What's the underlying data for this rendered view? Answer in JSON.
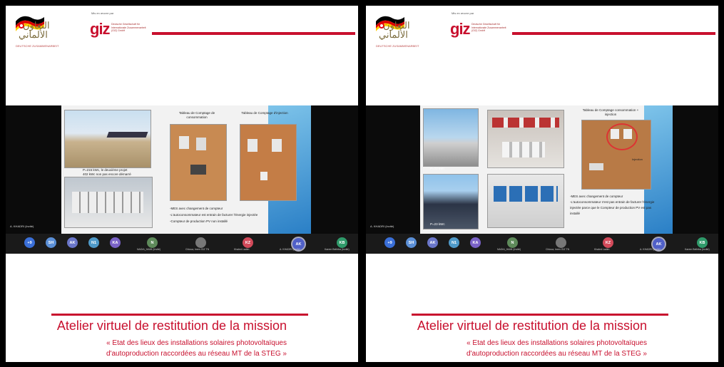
{
  "header": {
    "arabic_line1": "التعاون",
    "arabic_line2": "الألماني",
    "coop_label": "DEUTSCHE ZUSAMMENARBEIT",
    "mandate": "Mis en œuvre par",
    "giz_logo": "giz",
    "giz_desc": "Deutsche Gesellschaft für Internationale Zusammenarbeit (GIZ) GmbH"
  },
  "left": {
    "captions": [
      "P=215 kWc, le deuxième projet",
      "402 kWc non pas encore démarré"
    ],
    "board1_title": "Tableau de Comptage de consommation",
    "board2_title": "Tableau de Comptage d'injection",
    "bullets": [
      "-MES avec changement de compteur",
      "-L'autoconsommateur est entrain de facturer l'énergie injectée",
      "-Compteur de production PV non installé"
    ],
    "tile_name": "A. KHADRI (Invité)"
  },
  "right": {
    "photo_caption_1": "P=23 kWc",
    "photo_caption_2": "P=23 kWc",
    "board_title": "Tableau de Comptage consommation + injection",
    "injection_label": "Injection",
    "bullets": [
      "-MES avec changement de compteur",
      "-L'autoconsommateur n'est pas entrain de facturer l'énergie injectée parce que le Compteur de production PV est pas installé"
    ],
    "tile_name": "A. KHADRI (Invité)"
  },
  "participants": [
    {
      "initials": "+9",
      "color": "#3a6fd8"
    },
    {
      "initials": "SH",
      "color": "#5b8fd6"
    },
    {
      "initials": "AK",
      "color": "#6a76c9"
    },
    {
      "initials": "N1",
      "color": "#4f9ac9"
    },
    {
      "initials": "KA",
      "color": "#7a62c7"
    },
    {
      "initials": "N",
      "color": "#5e8a5a",
      "name": "NADIA_HAMI (Invité)"
    },
    {
      "initials": "",
      "color": "#777",
      "name": "Chloua, Imen GIZ TN"
    },
    {
      "initials": "KZ",
      "color": "#d24a5a",
      "name": "Khaled Ladim"
    },
    {
      "initials": "AK",
      "color": "#5060c8",
      "name": "A. KHADRI (Invité)"
    },
    {
      "initials": "KB",
      "color": "#2f9a6a",
      "name": "Karem Belhiba (Invité)"
    }
  ],
  "footer": {
    "title": "Atelier virtuel de restitution de la mission",
    "subtitle1": "« Etat des lieux des installations solaires photovoltaïques",
    "subtitle2": "d'autoproduction raccordées au réseau MT de la STEG »"
  },
  "colors": {
    "brand_red": "#c8102e",
    "blue": "#2a7fc6"
  }
}
